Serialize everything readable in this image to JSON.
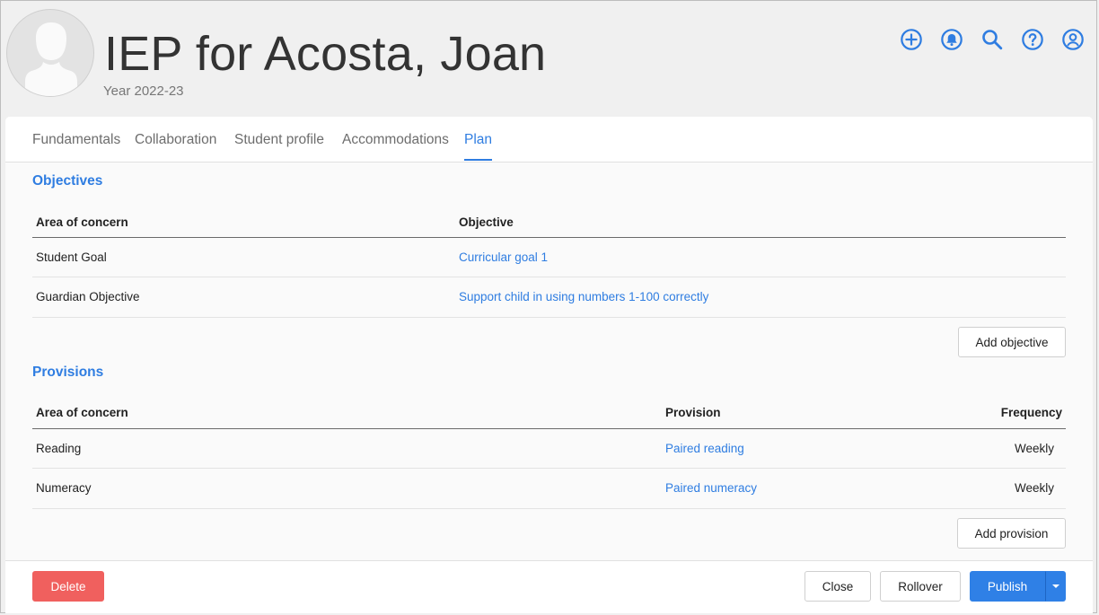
{
  "header": {
    "title": "IEP for Acosta, Joan",
    "subtitle": "Year 2022-23",
    "icons": [
      "add-circle-icon",
      "bell-icon",
      "search-icon",
      "help-icon",
      "account-icon"
    ]
  },
  "tabs": [
    {
      "label": "Fundamentals"
    },
    {
      "label": "Collaboration"
    },
    {
      "label": "Student profile"
    },
    {
      "label": "Accommodations"
    },
    {
      "label": "Plan",
      "active": true
    }
  ],
  "objectives": {
    "title": "Objectives",
    "columns": [
      "Area of concern",
      "Objective"
    ],
    "rows": [
      [
        "Student Goal",
        "Curricular goal 1"
      ],
      [
        "Guardian Objective",
        "Support child in using numbers 1-100 correctly"
      ]
    ],
    "add_label": "Add objective"
  },
  "provisions": {
    "title": "Provisions",
    "columns": [
      "Area of concern",
      "Provision",
      "Frequency"
    ],
    "rows": [
      [
        "Reading",
        "Paired reading",
        "Weekly"
      ],
      [
        "Numeracy",
        "Paired numeracy",
        "Weekly"
      ]
    ],
    "add_label": "Add provision"
  },
  "footer": {
    "delete_label": "Delete",
    "close_label": "Close",
    "rollover_label": "Rollover",
    "publish_label": "Publish"
  },
  "colors": {
    "accent": "#2f7de1",
    "danger": "#f0605e",
    "background": "#f0f0f0"
  }
}
